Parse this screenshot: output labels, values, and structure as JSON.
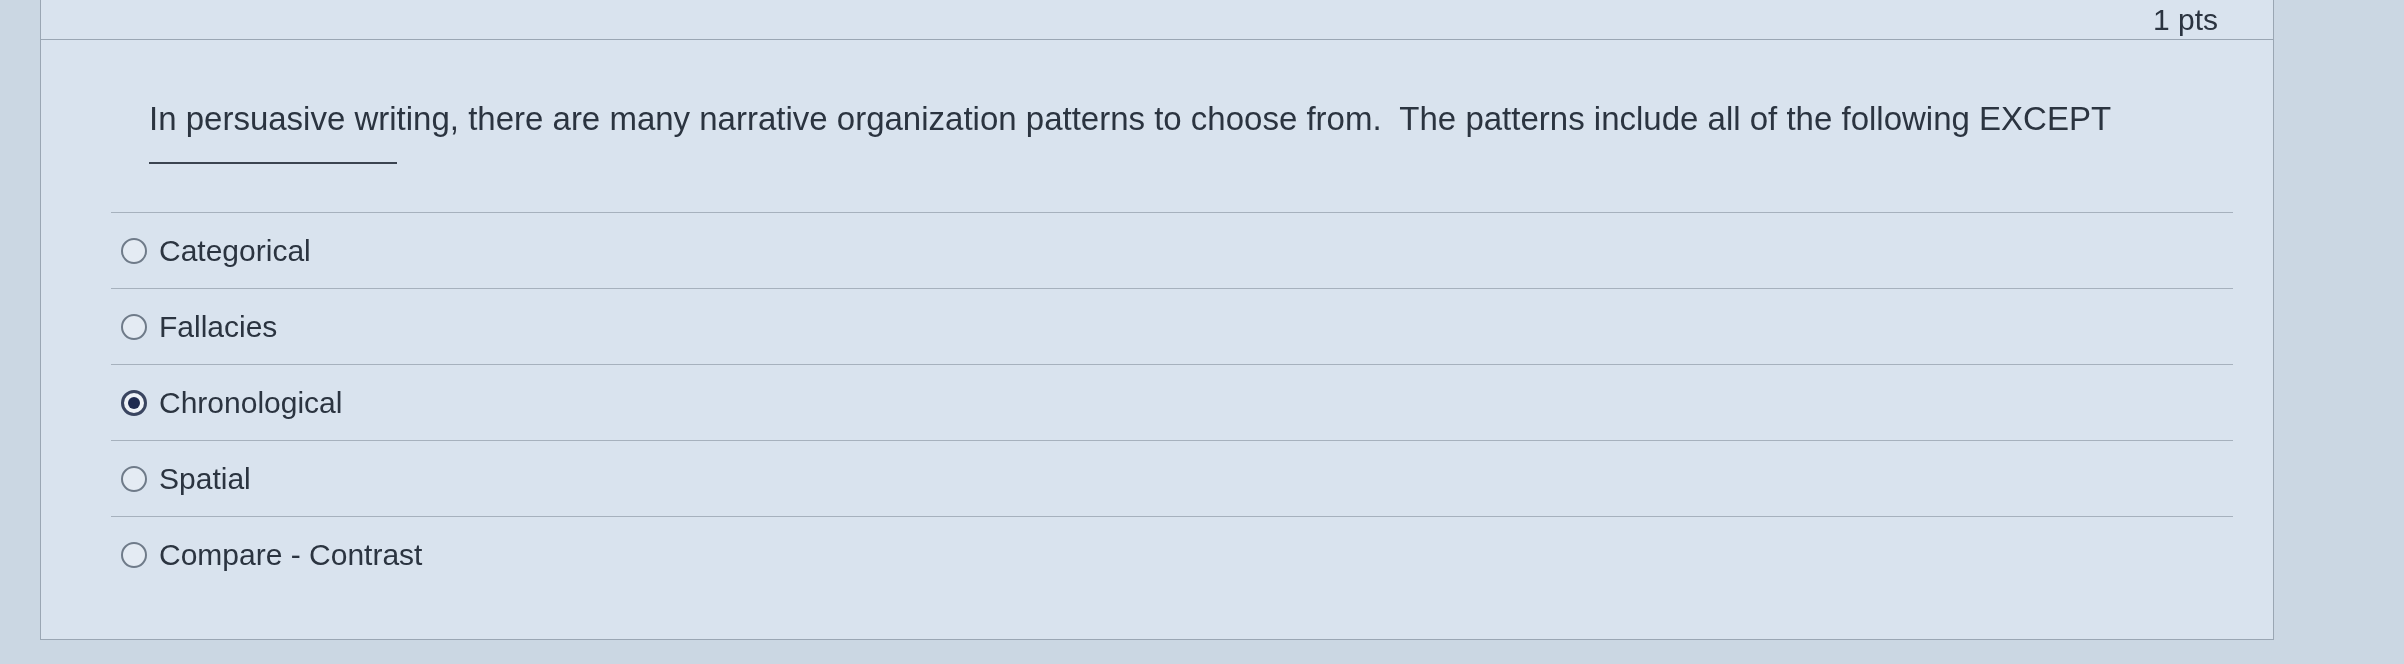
{
  "question": {
    "points": "1 pts",
    "text": "In persuasive writing, there are many narrative organization patterns to choose from.  The patterns include all of the following EXCEPT"
  },
  "options": [
    {
      "label": "Categorical",
      "selected": false
    },
    {
      "label": "Fallacies",
      "selected": false
    },
    {
      "label": "Chronological",
      "selected": true
    },
    {
      "label": "Spatial",
      "selected": false
    },
    {
      "label": "Compare - Contrast",
      "selected": false
    }
  ]
}
